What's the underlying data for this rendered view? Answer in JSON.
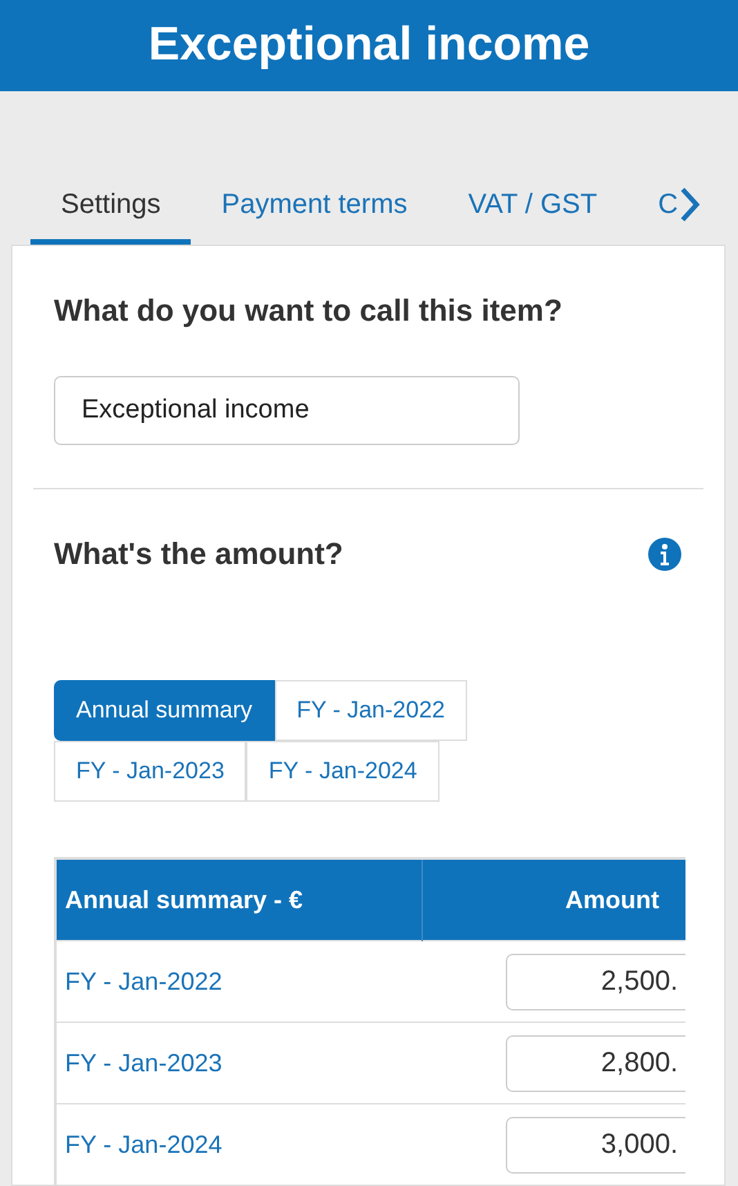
{
  "header": {
    "title": "Exceptional income"
  },
  "tabs": [
    {
      "label": "Settings",
      "selected": true
    },
    {
      "label": "Payment terms",
      "selected": false
    },
    {
      "label": "VAT / GST",
      "selected": false
    },
    {
      "label": "C",
      "selected": false
    }
  ],
  "name_section": {
    "question": "What do you want to call this item?",
    "value": "Exceptional income"
  },
  "amount_section": {
    "question": "What's the amount?",
    "periods": [
      {
        "label": "Annual summary",
        "selected": true
      },
      {
        "label": "FY - Jan-2022",
        "selected": false
      },
      {
        "label": "FY - Jan-2023",
        "selected": false
      },
      {
        "label": "FY - Jan-2024",
        "selected": false
      }
    ],
    "table": {
      "columns": [
        "Annual summary - €",
        "Amount"
      ],
      "rows": [
        {
          "period": "FY - Jan-2022",
          "amount": "2,500."
        },
        {
          "period": "FY - Jan-2023",
          "amount": "2,800."
        },
        {
          "period": "FY - Jan-2024",
          "amount": "3,000."
        }
      ]
    }
  }
}
